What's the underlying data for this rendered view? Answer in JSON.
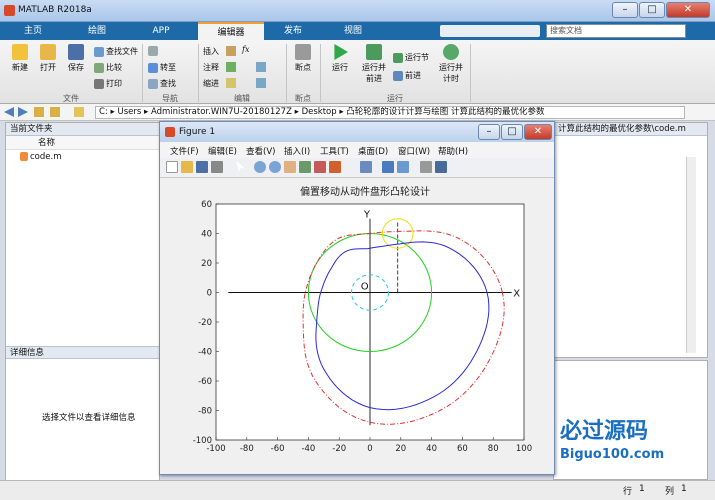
{
  "app": {
    "title": "MATLAB R2018a"
  },
  "window_buttons": [
    "–",
    "□",
    "✕"
  ],
  "tabs": [
    {
      "label": "主页"
    },
    {
      "label": "绘图"
    },
    {
      "label": "APP"
    },
    {
      "label": "编辑器"
    },
    {
      "label": "发布"
    },
    {
      "label": "视图"
    }
  ],
  "search": {
    "placeholder": "搜索文档"
  },
  "ribbon": {
    "file": {
      "new": "新建",
      "open": "打开",
      "save": "保存",
      "find_files": "查找文件",
      "compare": "比较",
      "print": "打印",
      "group": "文件"
    },
    "navigate": {
      "goto": "转至",
      "find": "查找",
      "group": "导航"
    },
    "edit": {
      "insert": "插入",
      "comment": "注释",
      "indent": "缩进",
      "fx": "fx",
      "group": "编辑"
    },
    "breakpoints": {
      "label": "断点",
      "group": "断点"
    },
    "run": {
      "run": "运行",
      "run_advance": "运行并\n前进",
      "run_section": "运行节",
      "advance": "前进",
      "run_time": "运行并\n计时",
      "group": "运行"
    }
  },
  "path": {
    "crumbs": [
      "C:",
      "Users",
      "Administrator.WIN7U-20180127Z",
      "Desktop",
      "凸轮轮廓的设计计算与绘图 计算此结构的最优化参数"
    ]
  },
  "left": {
    "current_folder": "当前文件夹",
    "name_col": "名称",
    "files": [
      "code.m"
    ],
    "details": "详细信息",
    "details_hint": "选择文件以查看详细信息"
  },
  "editor": {
    "tab": "计算此结构的最优化参数\\code.m"
  },
  "status": {
    "row_label": "行",
    "row": "1",
    "col_label": "列",
    "col": "1"
  },
  "figure": {
    "title": "Figure 1",
    "menu": [
      "文件(F)",
      "编辑(E)",
      "查看(V)",
      "插入(I)",
      "工具(T)",
      "桌面(D)",
      "窗口(W)",
      "帮助(H)"
    ]
  },
  "chart_data": {
    "type": "line",
    "title": "偏置移动从动件盘形凸轮设计",
    "xlim": [
      -100,
      100
    ],
    "ylim": [
      -100,
      60
    ],
    "xticks": [
      -100,
      -80,
      -60,
      -40,
      -20,
      0,
      20,
      40,
      60,
      80,
      100
    ],
    "yticks": [
      -100,
      -80,
      -60,
      -40,
      -20,
      0,
      20,
      40,
      60
    ],
    "axis_labels": {
      "x": "X",
      "y": "Y",
      "origin": "O"
    },
    "series": [
      {
        "kind": "circle",
        "cx": 0,
        "cy": 0,
        "r": 40,
        "color": "#1fd11f",
        "style": "solid"
      },
      {
        "kind": "circle",
        "cx": 0,
        "cy": 0,
        "r": 12,
        "color": "#29c6e6",
        "style": "dashed"
      },
      {
        "kind": "circle",
        "cx": 18,
        "cy": 40,
        "r": 10,
        "color": "#e8e000",
        "style": "solid"
      },
      {
        "kind": "polar",
        "color": "#2a2ad6",
        "style": "solid",
        "angles_deg": [
          0,
          30,
          60,
          90,
          120,
          150,
          180,
          210,
          240,
          270,
          300,
          330,
          360
        ],
        "radii": [
          76,
          60,
          38,
          30,
          32,
          30,
          32,
          40,
          60,
          78,
          82,
          80,
          76
        ]
      },
      {
        "kind": "polar",
        "color": "#e03030",
        "style": "dashdot",
        "angles_deg": [
          0,
          30,
          60,
          90,
          120,
          150,
          180,
          210,
          240,
          270,
          300,
          330,
          360
        ],
        "radii": [
          86,
          70,
          48,
          40,
          42,
          40,
          42,
          50,
          70,
          88,
          92,
          90,
          86
        ]
      }
    ]
  },
  "watermark": {
    "text": "必过源码",
    "url": "Biguo100.com"
  },
  "colors": {
    "accent": "#1e6aa8",
    "tab_active": "#f0a030"
  }
}
